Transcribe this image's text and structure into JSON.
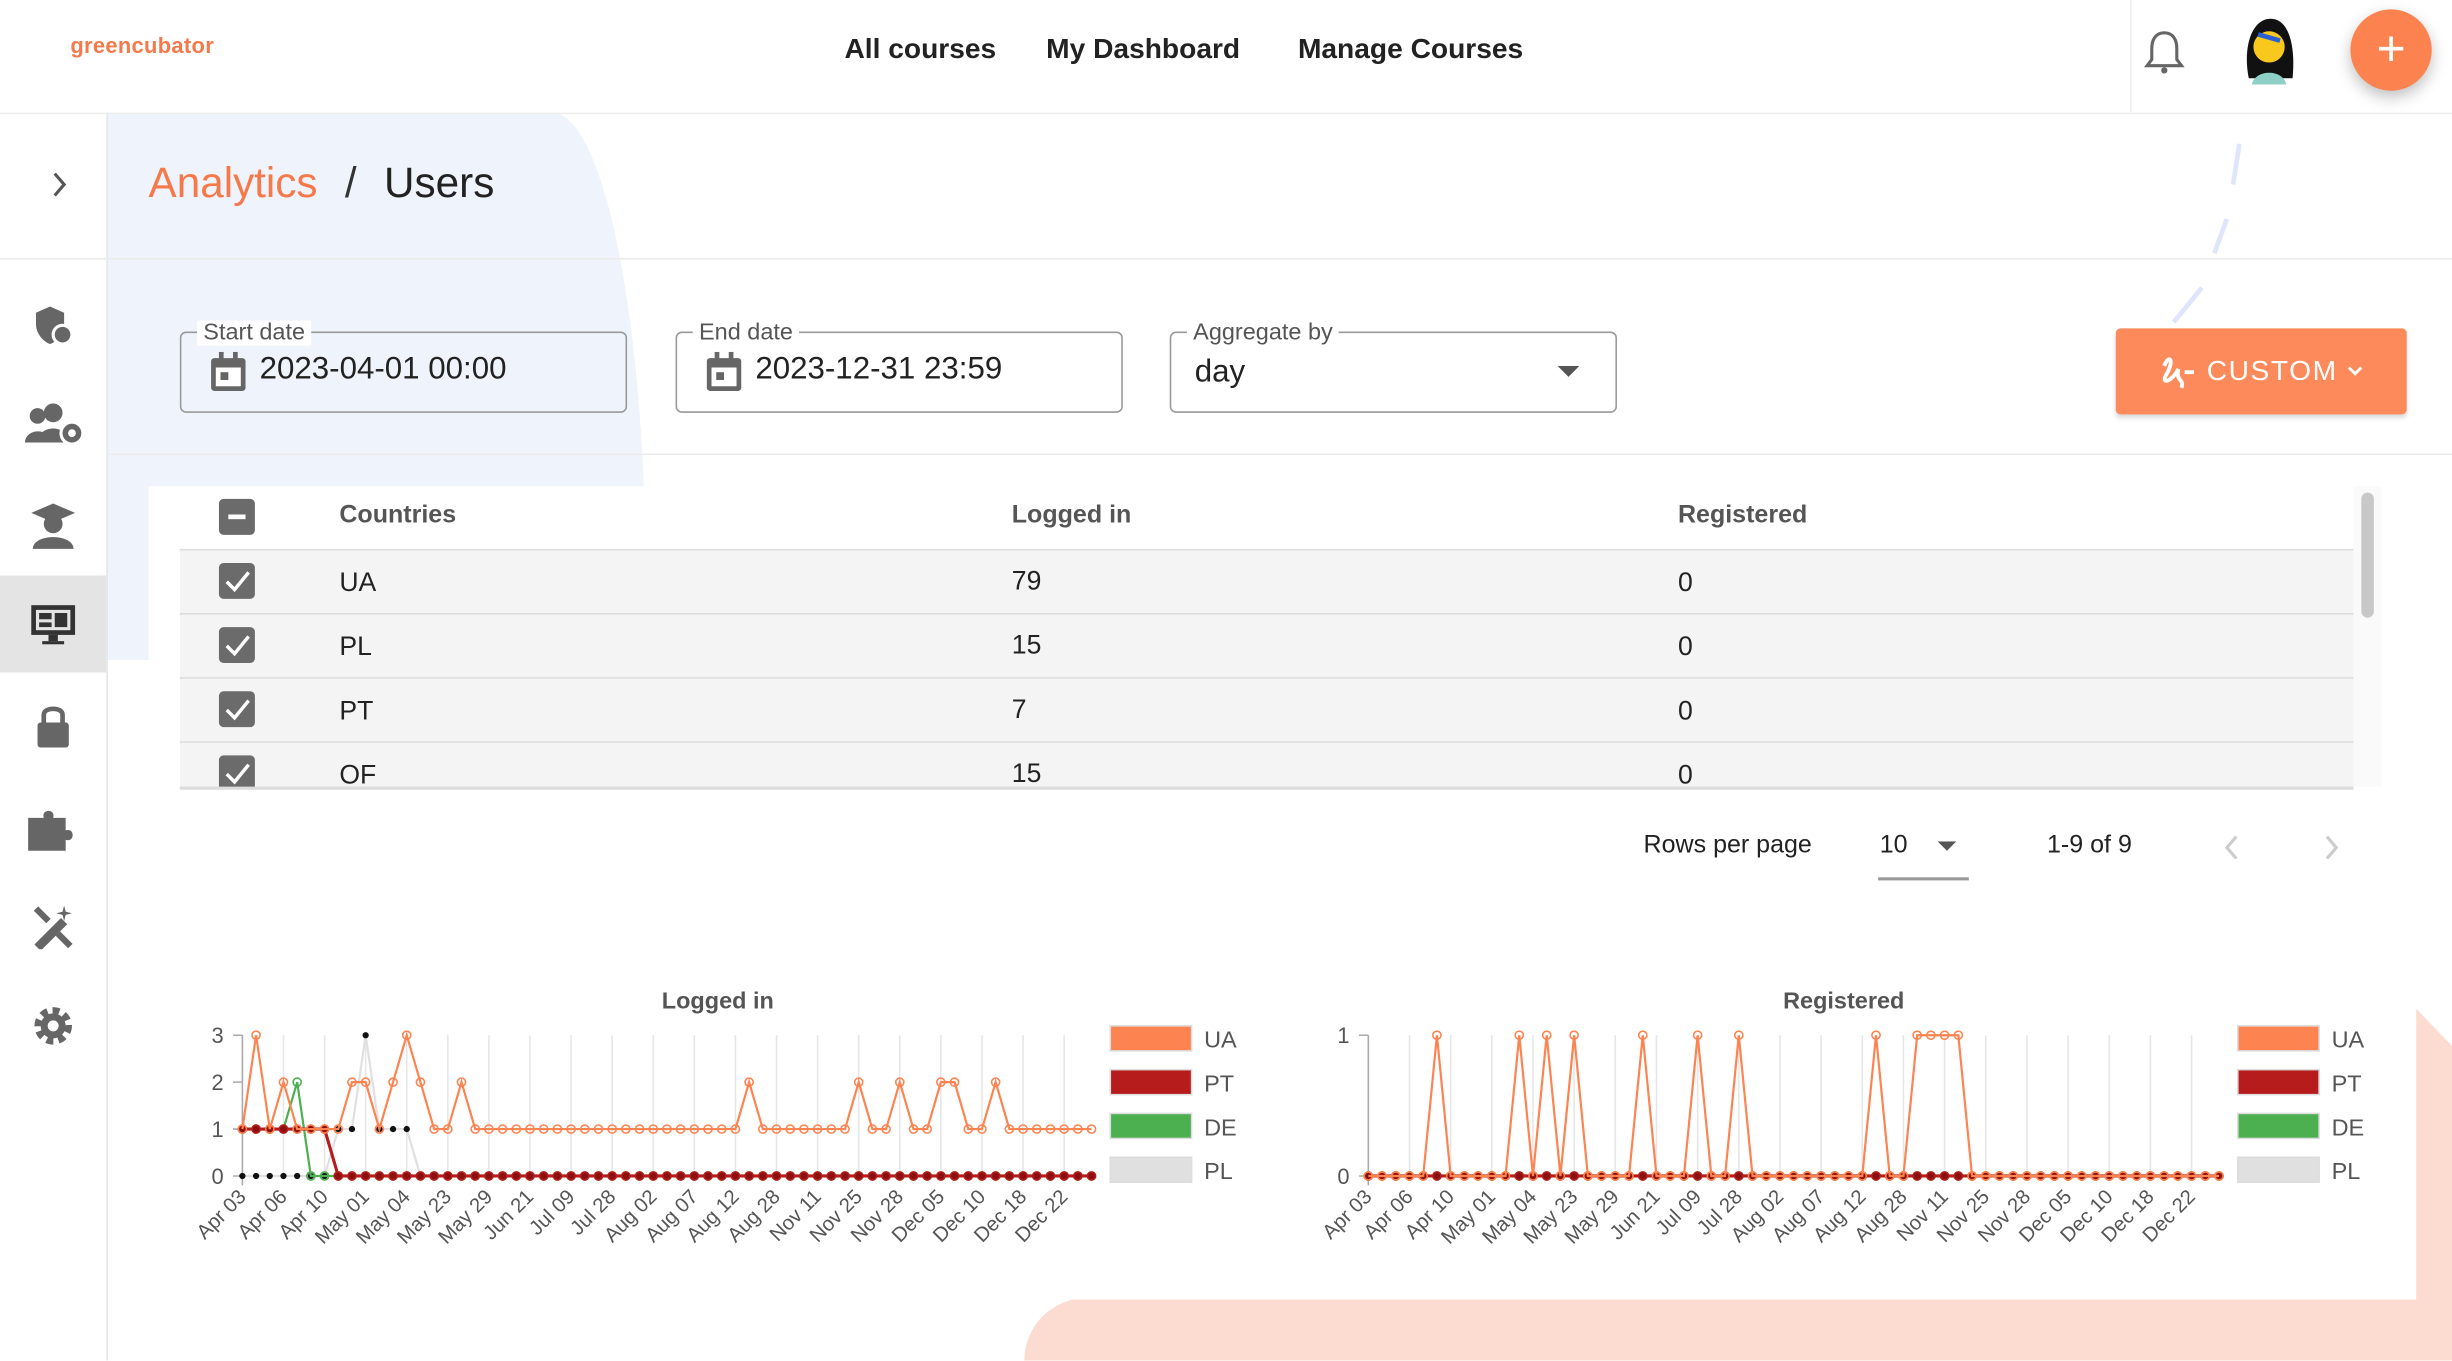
{
  "header": {
    "logo": "greencubator",
    "nav": [
      "All courses",
      "My Dashboard",
      "Manage Courses"
    ],
    "icons": [
      "bell-icon",
      "avatar",
      "plus-icon"
    ]
  },
  "sidebar": {
    "items": [
      "shield-user-icon",
      "users-gear-icon",
      "graduate-icon",
      "analytics-monitor-icon",
      "lock-icon",
      "puzzle-icon",
      "edit-tools-icon",
      "gear-icon"
    ],
    "active": "analytics-monitor-icon"
  },
  "breadcrumb": {
    "parent": "Analytics",
    "separator": "/",
    "current": "Users"
  },
  "filters": {
    "start_label": "Start date",
    "start_value": "2023-04-01 00:00",
    "end_label": "End date",
    "end_value": "2023-12-31 23:59",
    "aggregate_label": "Aggregate by",
    "aggregate_value": "day",
    "custom_label": "CUSTOM"
  },
  "colors": {
    "accent": "#fc8a5b",
    "UA": "#fd8350",
    "PT": "#b71c1c",
    "DE": "#4caf50",
    "PL": "#e0e0e0"
  },
  "table": {
    "columns": [
      "Countries",
      "Logged in",
      "Registered"
    ],
    "rows": [
      {
        "country": "UA",
        "logged": "79",
        "registered": "0",
        "checked": true
      },
      {
        "country": "PL",
        "logged": "15",
        "registered": "0",
        "checked": true
      },
      {
        "country": "PT",
        "logged": "7",
        "registered": "0",
        "checked": true
      },
      {
        "country": "OF",
        "logged": "15",
        "registered": "0",
        "checked": true
      }
    ]
  },
  "pagination": {
    "rows_label": "Rows per page",
    "rows_value": "10",
    "range": "1-9 of 9"
  },
  "chart_data": [
    {
      "type": "line",
      "title": "Logged in",
      "ylim": [
        0,
        3
      ],
      "yticks": [
        "0",
        "1",
        "2",
        "3"
      ],
      "xtick_labels": [
        "Apr 03",
        "Apr 06",
        "Apr 10",
        "May 01",
        "May 04",
        "May 23",
        "May 29",
        "Jun 21",
        "Jul 09",
        "Jul 28",
        "Aug 02",
        "Aug 07",
        "Aug 12",
        "Aug 28",
        "Nov 11",
        "Nov 25",
        "Nov 28",
        "Dec 05",
        "Dec 10",
        "Dec 18",
        "Dec 22"
      ],
      "legend": "right",
      "series": [
        {
          "name": "UA",
          "values": [
            1,
            3,
            1,
            2,
            1,
            1,
            1,
            1,
            2,
            2,
            1,
            2,
            3,
            2,
            1,
            1,
            2,
            1,
            1,
            1,
            1,
            1,
            1,
            1,
            1,
            1,
            1,
            1,
            1,
            1,
            1,
            1,
            1,
            1,
            1,
            1,
            1,
            2,
            1,
            1,
            1,
            1,
            1,
            1,
            1,
            2,
            1,
            1,
            2,
            1,
            1,
            2,
            2,
            1,
            1,
            2,
            1,
            1,
            1,
            1,
            1,
            1,
            1
          ]
        },
        {
          "name": "PT",
          "values": [
            1,
            1,
            1,
            1,
            1,
            1,
            1,
            0,
            0,
            0,
            0,
            0,
            0,
            0,
            0,
            0,
            0,
            0,
            0,
            0,
            0,
            0,
            0,
            0,
            0,
            0,
            0,
            0,
            0,
            0,
            0,
            0,
            0,
            0,
            0,
            0,
            0,
            0,
            0,
            0,
            0,
            0,
            0,
            0,
            0,
            0,
            0,
            0,
            0,
            0,
            0,
            0,
            0,
            0,
            0,
            0,
            0,
            0,
            0,
            0,
            0,
            0,
            0
          ]
        },
        {
          "name": "DE",
          "values": [
            1,
            1,
            1,
            1,
            2,
            0,
            0,
            0,
            0,
            0,
            0,
            0,
            0,
            0,
            0,
            0,
            0,
            0,
            0,
            0,
            0,
            0,
            0,
            0,
            0,
            0,
            0,
            0,
            0,
            0,
            0,
            0,
            0,
            0,
            0,
            0,
            0,
            0,
            0,
            0,
            0,
            0,
            0,
            0,
            0,
            0,
            0,
            0,
            0,
            0,
            0,
            0,
            0,
            0,
            0,
            0,
            0,
            0,
            0,
            0,
            0,
            0,
            0
          ]
        },
        {
          "name": "PL",
          "values": [
            0,
            0,
            0,
            0,
            0,
            0,
            0,
            1,
            1,
            3,
            1,
            1,
            1,
            0,
            0,
            0,
            0,
            0,
            0,
            0,
            0,
            0,
            0,
            0,
            0,
            0,
            0,
            0,
            0,
            0,
            0,
            0,
            0,
            0,
            0,
            0,
            0,
            0,
            0,
            0,
            0,
            0,
            0,
            0,
            0,
            0,
            0,
            0,
            0,
            0,
            0,
            0,
            0,
            0,
            0,
            0,
            0,
            0,
            0,
            0,
            0,
            0,
            0
          ]
        }
      ]
    },
    {
      "type": "line",
      "title": "Registered",
      "ylim": [
        0,
        1
      ],
      "yticks": [
        "0",
        "1"
      ],
      "xtick_labels": [
        "Apr 03",
        "Apr 06",
        "Apr 10",
        "May 01",
        "May 04",
        "May 23",
        "May 29",
        "Jun 21",
        "Jul 09",
        "Jul 28",
        "Aug 02",
        "Aug 07",
        "Aug 12",
        "Aug 28",
        "Nov 11",
        "Nov 25",
        "Nov 28",
        "Dec 05",
        "Dec 10",
        "Dec 18",
        "Dec 22"
      ],
      "legend": "right",
      "series": [
        {
          "name": "UA",
          "values": [
            0,
            0,
            0,
            0,
            0,
            1,
            0,
            0,
            0,
            0,
            0,
            1,
            0,
            1,
            0,
            1,
            0,
            0,
            0,
            0,
            1,
            0,
            0,
            0,
            1,
            0,
            0,
            1,
            0,
            0,
            0,
            0,
            0,
            0,
            0,
            0,
            0,
            1,
            0,
            0,
            1,
            1,
            1,
            1,
            0,
            0,
            0,
            0,
            0,
            0,
            0,
            0,
            0,
            0,
            0,
            0,
            0,
            0,
            0,
            0,
            0,
            0,
            0
          ]
        },
        {
          "name": "PT",
          "values": [
            0,
            0,
            0,
            0,
            0,
            0,
            0,
            0,
            0,
            0,
            0,
            0,
            0,
            0,
            0,
            0,
            0,
            0,
            0,
            0,
            0,
            0,
            0,
            0,
            0,
            0,
            0,
            0,
            0,
            0,
            0,
            0,
            0,
            0,
            0,
            0,
            0,
            0,
            0,
            0,
            0,
            0,
            0,
            0,
            0,
            0,
            0,
            0,
            0,
            0,
            0,
            0,
            0,
            0,
            0,
            0,
            0,
            0,
            0,
            0,
            0,
            0,
            0
          ]
        },
        {
          "name": "DE",
          "values": [
            0,
            0,
            0,
            0,
            0,
            0,
            0,
            0,
            0,
            0,
            0,
            0,
            0,
            0,
            0,
            0,
            0,
            0,
            0,
            0,
            0,
            0,
            0,
            0,
            0,
            0,
            0,
            0,
            0,
            0,
            0,
            0,
            0,
            0,
            0,
            0,
            0,
            0,
            0,
            0,
            0,
            0,
            0,
            0,
            0,
            0,
            0,
            0,
            0,
            0,
            0,
            0,
            0,
            0,
            0,
            0,
            0,
            0,
            0,
            0,
            0,
            0,
            0
          ]
        },
        {
          "name": "PL",
          "values": [
            0,
            0,
            0,
            0,
            0,
            0,
            0,
            0,
            0,
            0,
            0,
            0,
            0,
            0,
            0,
            0,
            0,
            0,
            0,
            0,
            0,
            0,
            0,
            0,
            0,
            0,
            0,
            0,
            0,
            0,
            0,
            0,
            0,
            0,
            0,
            0,
            0,
            0,
            0,
            0,
            0,
            0,
            0,
            0,
            0,
            0,
            0,
            0,
            0,
            0,
            0,
            0,
            0,
            0,
            0,
            0,
            0,
            0,
            0,
            0,
            0,
            0,
            0
          ]
        }
      ]
    }
  ]
}
